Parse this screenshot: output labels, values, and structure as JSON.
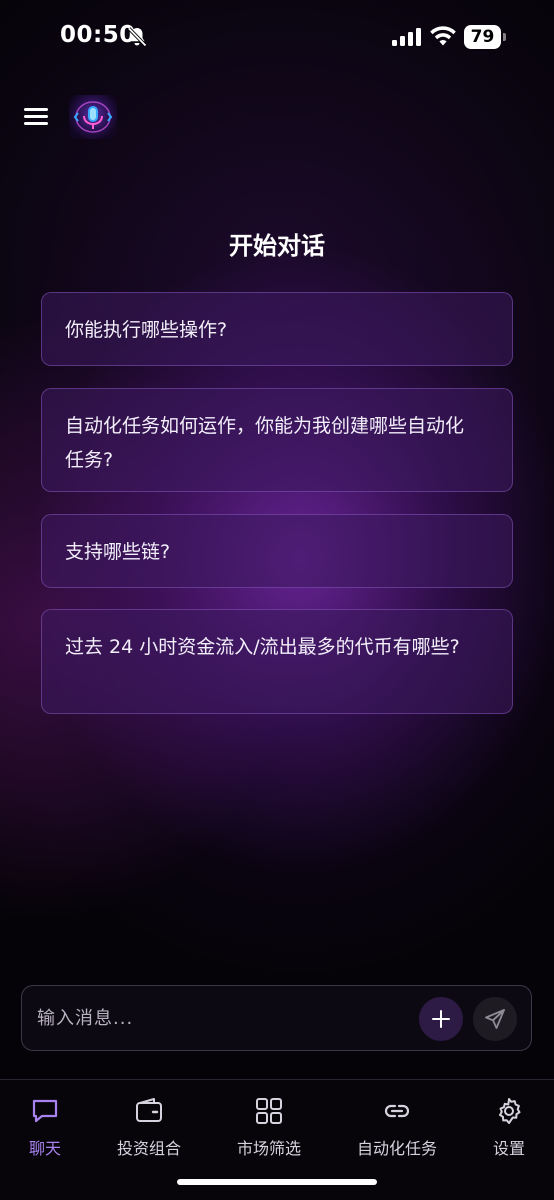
{
  "status_bar": {
    "time": "00:50",
    "battery": "79"
  },
  "header": {
    "menu_icon": "hamburger-menu-icon",
    "logo_icon": "app-logo-icon"
  },
  "main": {
    "title": "开始对话",
    "suggestions": [
      {
        "text": "你能执行哪些操作?"
      },
      {
        "text": "自动化任务如何运作，你能为我创建哪些自动化任务?"
      },
      {
        "text": "支持哪些链?"
      },
      {
        "text": "过去 24 小时资金流入/流出最多的代币有哪些?"
      }
    ]
  },
  "composer": {
    "placeholder": "输入消息...",
    "add_icon": "plus-icon",
    "send_icon": "paper-plane-icon"
  },
  "bottom_nav": {
    "items": [
      {
        "label": "聊天",
        "icon": "chat-bubble-icon",
        "active": true
      },
      {
        "label": "投资组合",
        "icon": "wallet-icon",
        "active": false
      },
      {
        "label": "市场筛选",
        "icon": "grid-icon",
        "active": false
      },
      {
        "label": "自动化任务",
        "icon": "link-icon",
        "active": false
      },
      {
        "label": "设置",
        "icon": "gear-icon",
        "active": false
      }
    ]
  },
  "colors": {
    "accent": "#a883f0",
    "card_background": "#3c1f5f",
    "card_border": "#9664d2",
    "background": "#050308"
  }
}
